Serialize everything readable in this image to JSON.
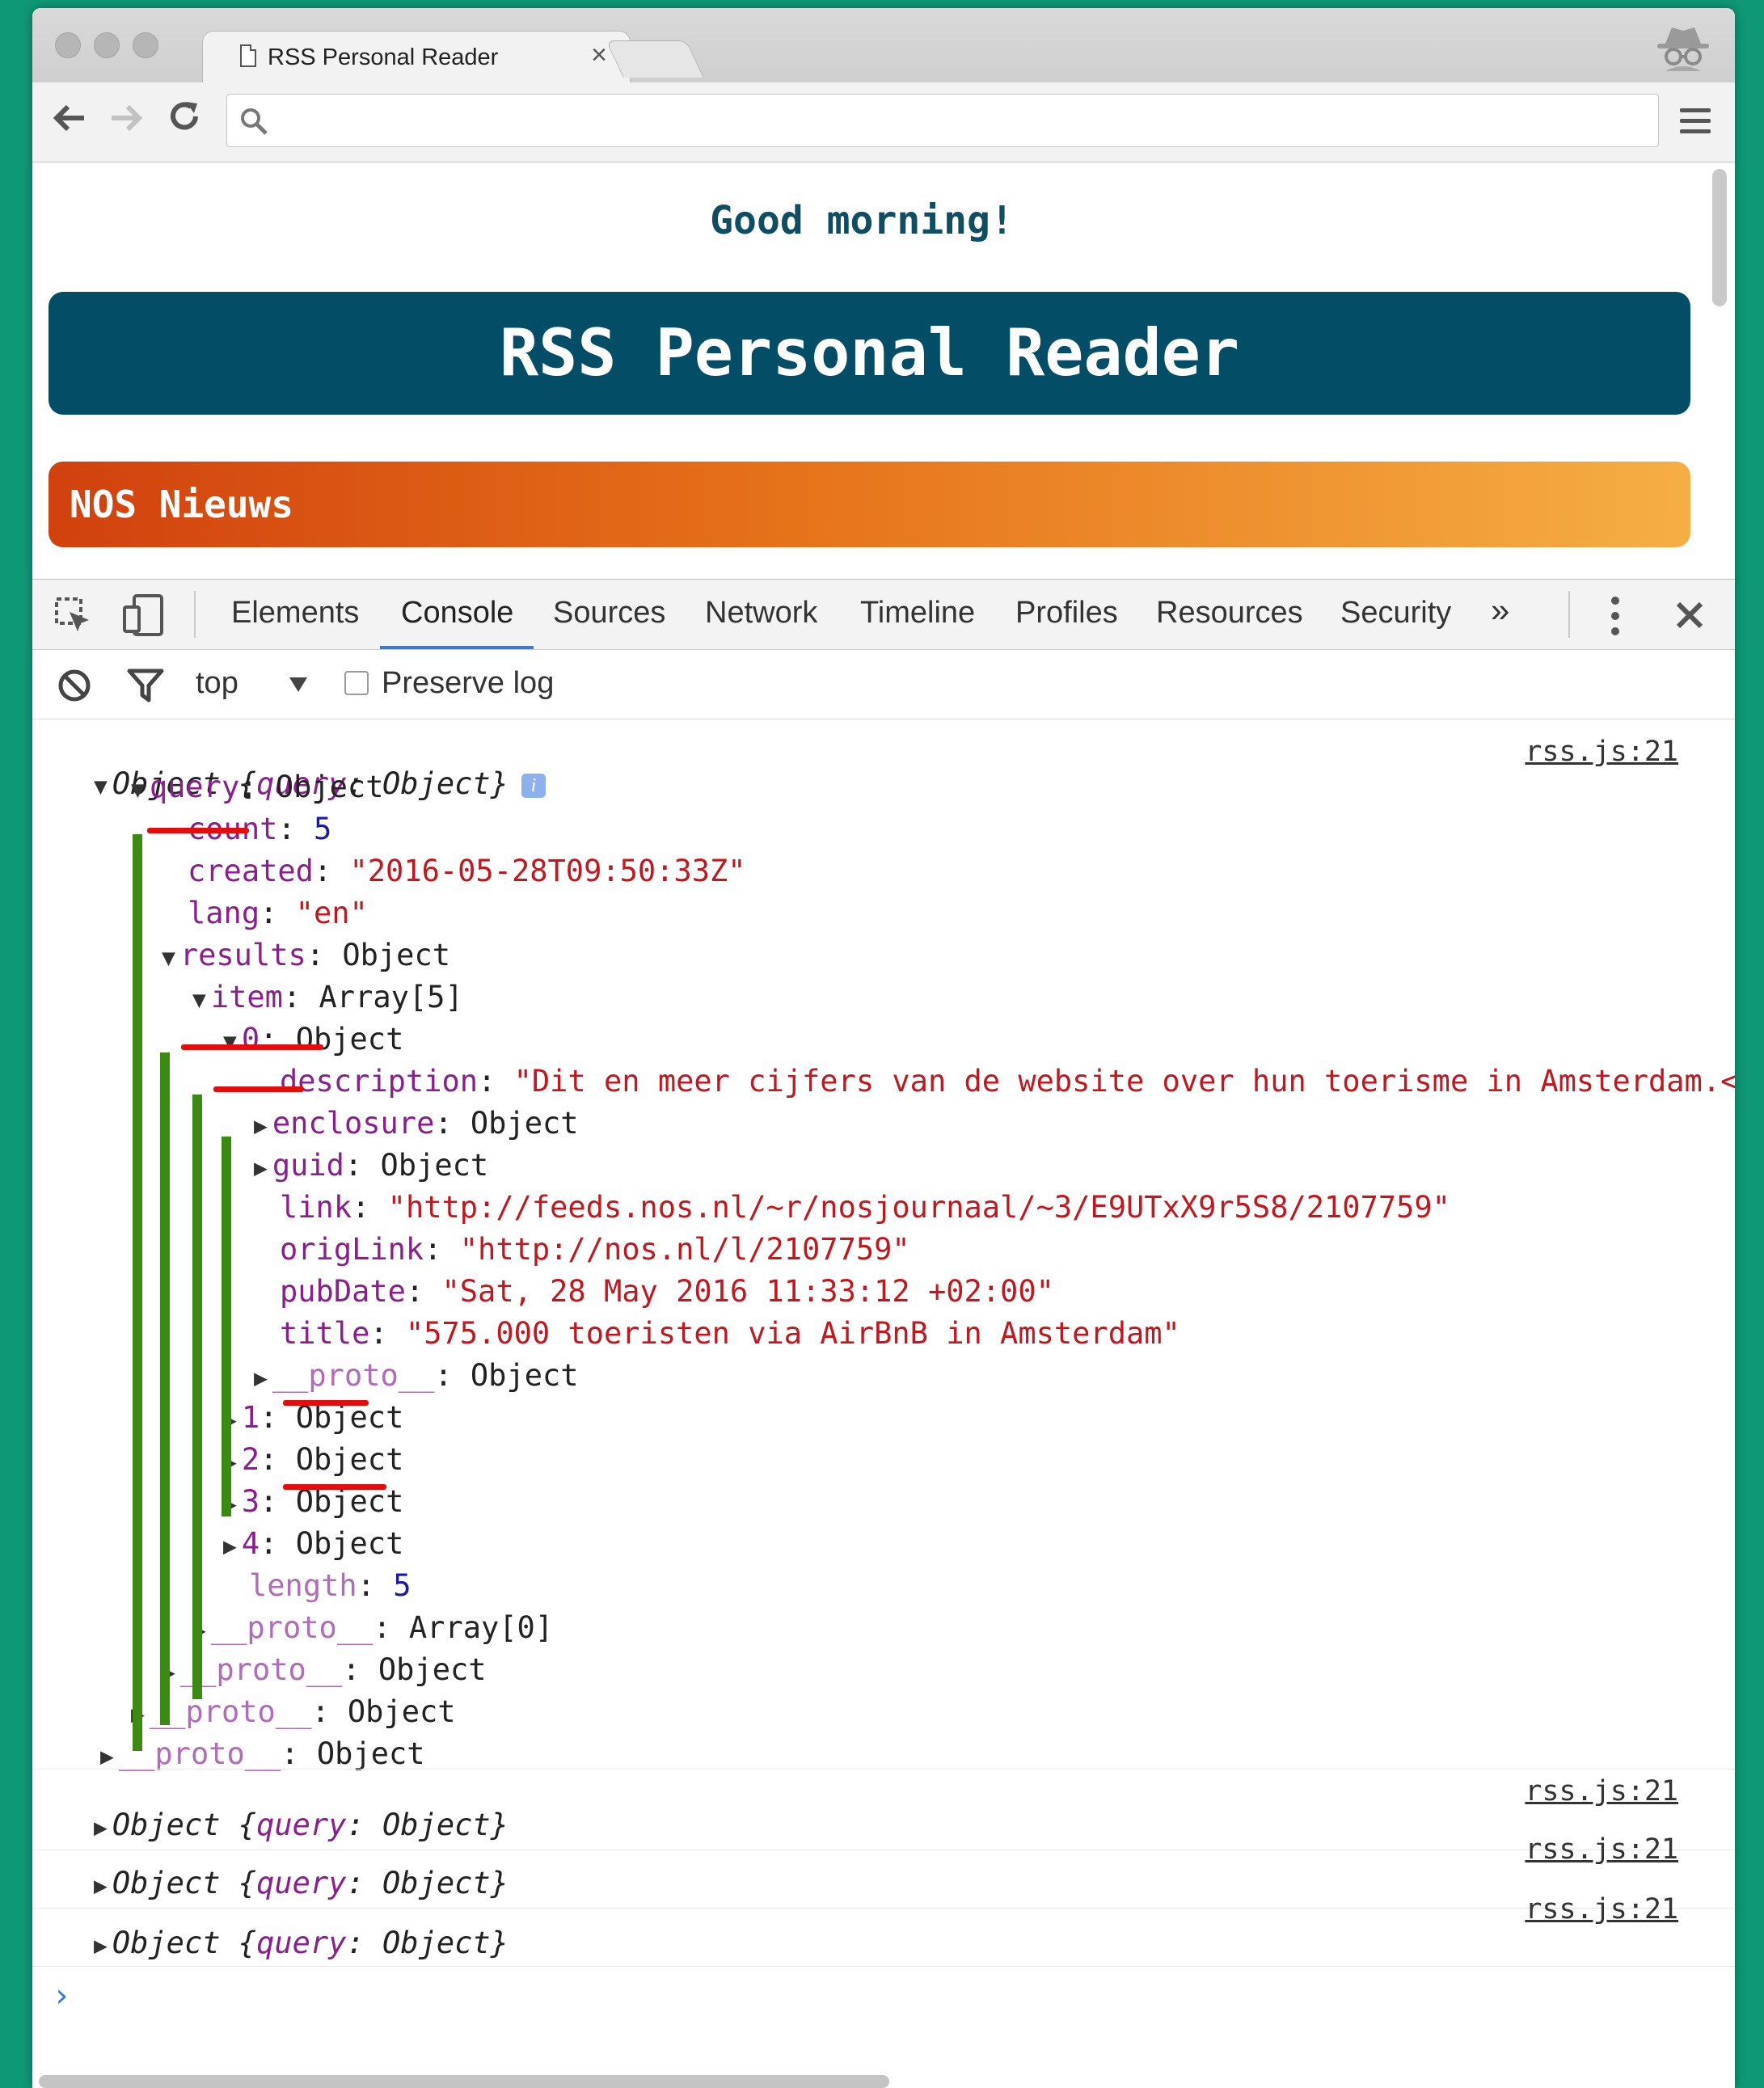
{
  "browser": {
    "tab_title": "RSS Personal Reader",
    "tab_close": "×",
    "omnibox_value": ""
  },
  "page": {
    "greeting": "Good morning!",
    "header": "RSS Personal Reader",
    "feed_title": "NOS Nieuws"
  },
  "devtools": {
    "tabs": [
      "Elements",
      "Console",
      "Sources",
      "Network",
      "Timeline",
      "Profiles",
      "Resources",
      "Security"
    ],
    "active_tab": "Console",
    "more_tabs": "»",
    "context": "top",
    "preserve_log": "Preserve log",
    "preserve_log_checked": false
  },
  "console": {
    "source": "rss.js:21",
    "root_summary": "Object",
    "root_preview": "{query: Object}",
    "lines": {
      "query": [
        "query",
        "Object"
      ],
      "count": [
        "count",
        "5"
      ],
      "created": [
        "created",
        "\"2016-05-28T09:50:33Z\""
      ],
      "lang": [
        "lang",
        "\"en\""
      ],
      "results": [
        "results",
        "Object"
      ],
      "item": [
        "item",
        "Array[5]"
      ],
      "item0": [
        "0",
        "Object"
      ],
      "description": [
        "description",
        "\"Dit en meer cijfers van de website over hun toerisme in Amsterdam.<img"
      ],
      "enclosure": [
        "enclosure",
        "Object"
      ],
      "guid": [
        "guid",
        "Object"
      ],
      "link": [
        "link",
        "\"http://feeds.nos.nl/~r/nosjournaal/~3/E9UTxX9r5S8/2107759\""
      ],
      "origLink": [
        "origLink",
        "\"http://nos.nl/l/2107759\""
      ],
      "pubDate": [
        "pubDate",
        "\"Sat, 28 May 2016 11:33:12 +02:00\""
      ],
      "title": [
        "title",
        "\"575.000 toeristen via AirBnB in Amsterdam\""
      ],
      "proto0": [
        "__proto__",
        "Object"
      ],
      "item1": [
        "1",
        "Object"
      ],
      "item2": [
        "2",
        "Object"
      ],
      "item3": [
        "3",
        "Object"
      ],
      "item4": [
        "4",
        "Object"
      ],
      "length": [
        "length",
        "5"
      ],
      "protoArr": [
        "__proto__",
        "Array[0]"
      ],
      "protoResults": [
        "__proto__",
        "Object"
      ],
      "protoQuery": [
        "__proto__",
        "Object"
      ],
      "protoRoot": [
        "__proto__",
        "Object"
      ]
    },
    "collapsed_messages": [
      {
        "summary": "Object",
        "preview": "{query: Object}",
        "source": "rss.js:21"
      },
      {
        "summary": "Object",
        "preview": "{query: Object}",
        "source": "rss.js:21"
      },
      {
        "summary": "Object",
        "preview": "{query: Object}",
        "source": "rss.js:21"
      }
    ],
    "prompt": "›"
  },
  "colors": {
    "background": "#0f9876",
    "banner": "#034e66",
    "annotation_green": "#3d8a12",
    "annotation_red": "#e40d0d"
  }
}
